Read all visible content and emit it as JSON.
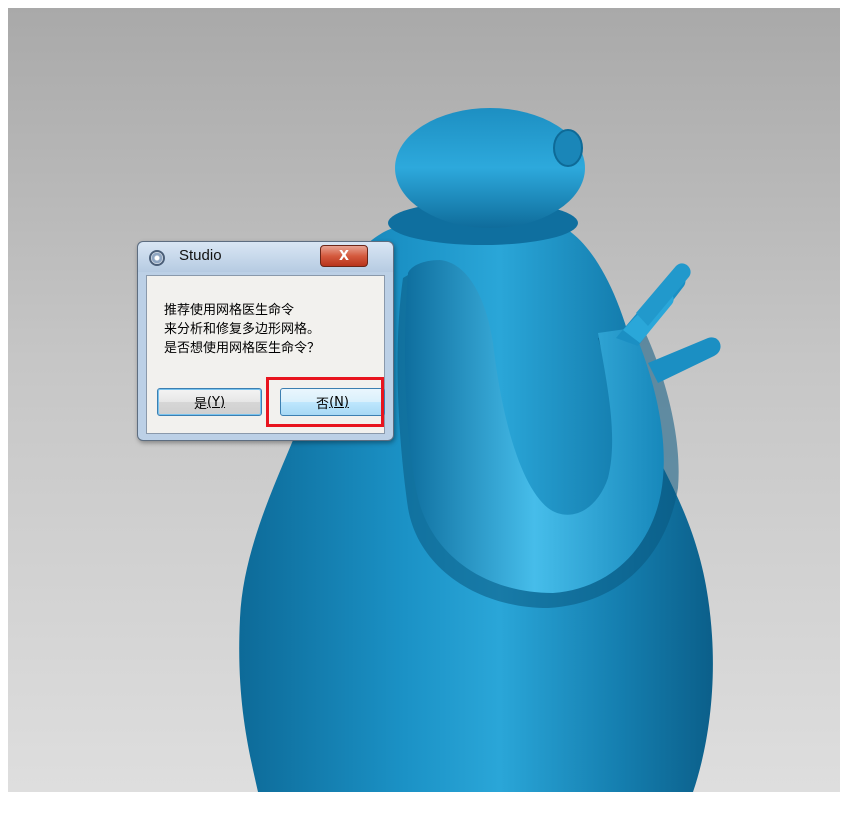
{
  "dialog": {
    "title": "Studio",
    "close_label": "X",
    "message_lines": [
      "推荐使用网格医生命令",
      "来分析和修复多边形网格。",
      "是否想使用网格医生命令？"
    ],
    "yes_button": {
      "label": "是",
      "hotkey": "(Y)"
    },
    "no_button": {
      "label": "否",
      "hotkey": "(N)"
    }
  },
  "icons": {
    "app_icon": "studio-app-icon",
    "close_icon": "close-icon"
  },
  "colors": {
    "model_blue": "#1787b8",
    "highlight_red": "#e8141e",
    "close_red": "#c8452b"
  }
}
